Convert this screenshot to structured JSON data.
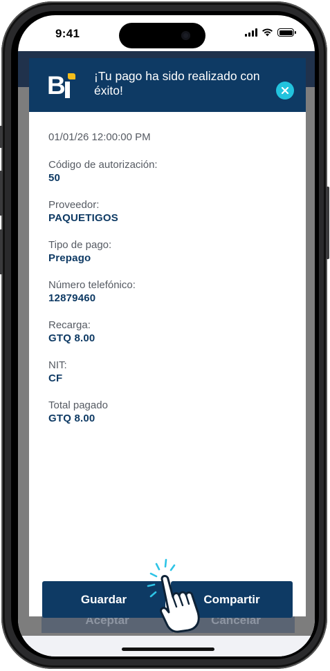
{
  "status_bar": {
    "time": "9:41"
  },
  "backdrop": {
    "left_button_label": "Aceptar",
    "right_button_label": "Cancelar"
  },
  "modal": {
    "title": "¡Tu pago ha sido realizado con éxito!",
    "logo_text": "Bi",
    "date": "01/01/26 12:00:00 PM",
    "fields": [
      {
        "label": "Código de autorización:",
        "value": "50"
      },
      {
        "label": "Proveedor:",
        "value": "PAQUETIGOS"
      },
      {
        "label": "Tipo de pago:",
        "value": "Prepago"
      },
      {
        "label": "Número telefónico:",
        "value": "12879460"
      },
      {
        "label": "Recarga:",
        "value": "GTQ 8.00"
      },
      {
        "label": "NIT:",
        "value": "CF"
      },
      {
        "label": "Total pagado",
        "value": "GTQ 8.00"
      }
    ],
    "save_button_label": "Guardar",
    "share_button_label": "Compartir"
  },
  "colors": {
    "brand_navy": "#0e3a64",
    "close_accent": "#22c3de",
    "logo_accent": "#f3bd1b"
  },
  "icons": [
    "close-icon",
    "signal-icon",
    "wifi-icon",
    "battery-icon",
    "tap-hand-icon",
    "bi-logo"
  ]
}
